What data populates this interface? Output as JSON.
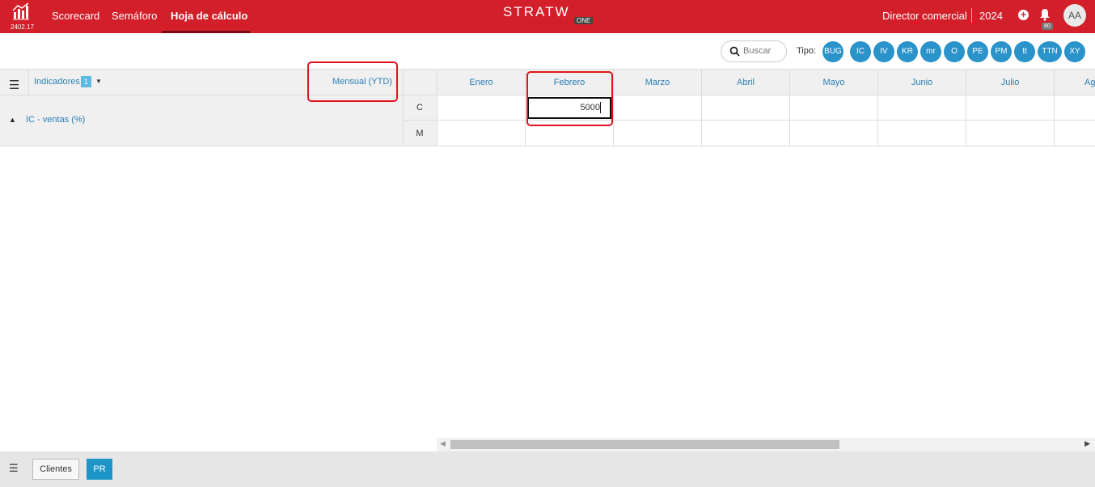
{
  "header": {
    "version": "2402.17",
    "nav": [
      {
        "label": "Scorecard"
      },
      {
        "label": "Semáforo"
      },
      {
        "label": "Hoja de cálculo",
        "active": true
      }
    ],
    "brand": "STRATW",
    "brand_suffix": "ONE",
    "role": "Director comercial",
    "year": "2024",
    "notifications": "80",
    "avatar": "AA"
  },
  "toolbar": {
    "search_placeholder": "Buscar",
    "tipo_label": "Tipo:",
    "types": [
      "BUG",
      "IC",
      "IV",
      "KR",
      "mr",
      "O",
      "PE",
      "PM",
      "tt",
      "TTN",
      "XY"
    ]
  },
  "grid": {
    "indicators_label": "Indicadores",
    "indicators_count": "1",
    "period_label": "Mensual (YTD)",
    "months": [
      "Enero",
      "Febrero",
      "Marzo",
      "Abril",
      "Mayo",
      "Junio",
      "Julio",
      "Ag"
    ],
    "indicator": "IC - ventas (%)",
    "row_labels": [
      "C",
      "M"
    ],
    "edit_value": "5000"
  },
  "footer": {
    "tabs": [
      "Clientes",
      "PR"
    ]
  },
  "colors": {
    "brand_red": "#d21f2a",
    "accent_blue": "#2a93c9",
    "highlight": "#e0141c"
  }
}
